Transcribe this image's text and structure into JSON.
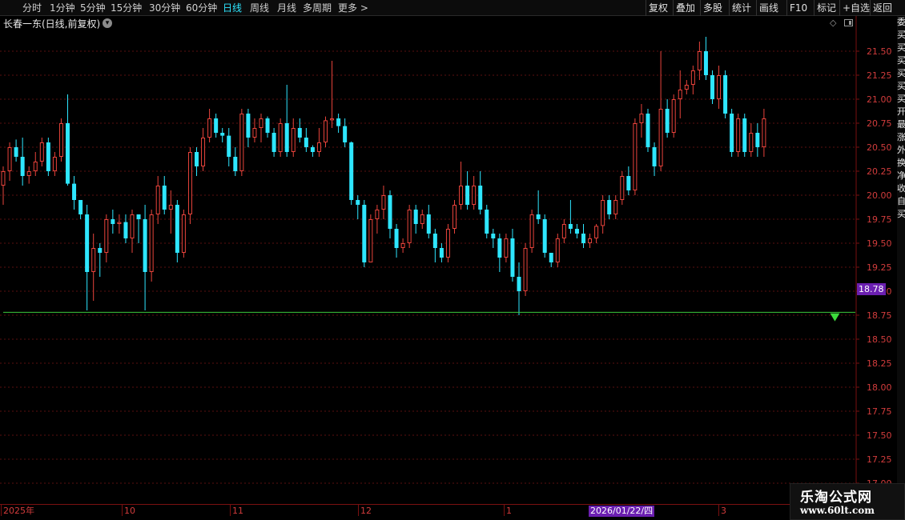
{
  "toolbar": {
    "left_items": [
      {
        "label": "分时",
        "active": false
      },
      {
        "label": "1分钟",
        "active": false
      },
      {
        "label": "5分钟",
        "active": false
      },
      {
        "label": "15分钟",
        "active": false
      },
      {
        "label": "30分钟",
        "active": false
      },
      {
        "label": "60分钟",
        "active": false
      },
      {
        "label": "日线",
        "active": true
      },
      {
        "label": "周线",
        "active": false
      },
      {
        "label": "月线",
        "active": false
      },
      {
        "label": "多周期",
        "active": false
      },
      {
        "label": "更多 >",
        "active": false
      }
    ],
    "right_items": [
      "复权",
      "叠加",
      "多股",
      "统计",
      "画线",
      "F10",
      "标记",
      "+自选",
      "返回"
    ]
  },
  "chart_header": {
    "title": "长春一东(日线,前复权)",
    "dropdown_icon": "chevron-down-icon"
  },
  "right_strip_chars": [
    "委",
    "买",
    "买",
    "买",
    "买",
    "买",
    "买",
    "开",
    "最",
    "涨",
    "外",
    "换",
    "净",
    "收",
    "自",
    "买"
  ],
  "date_axis": {
    "labels": [
      "2025年",
      "10",
      "11",
      "12",
      "1",
      "3"
    ],
    "highlight": "2026/01/22/四"
  },
  "current_price": "18.78",
  "watermark": {
    "title": "乐淘公式网",
    "url": "www.60lt.com"
  },
  "colors": {
    "up": "#e8433b",
    "down": "#2ee6ff",
    "grid": "#5a1010",
    "axis_text": "#d23c3c",
    "price_line": "#3cc83c",
    "highlight": "#6b1fb0"
  },
  "chart_data": {
    "type": "candlestick",
    "title": "长春一东(日线,前复权)",
    "yticks": [
      "21.50",
      "21.25",
      "21.00",
      "20.75",
      "20.50",
      "20.25",
      "20.00",
      "19.75",
      "19.50",
      "19.25",
      "19.00",
      "18.75",
      "18.50",
      "18.25",
      "18.00",
      "17.75",
      "17.50",
      "17.25",
      "17.00"
    ],
    "ylim": [
      16.8,
      21.7
    ],
    "reference_line": 18.78,
    "signal_marker": {
      "index": 129,
      "price": 18.72
    },
    "candles": [
      [
        20.1,
        20.3,
        19.9,
        20.25
      ],
      [
        20.25,
        20.55,
        20.15,
        20.5
      ],
      [
        20.5,
        20.58,
        20.35,
        20.4
      ],
      [
        20.4,
        20.6,
        20.1,
        20.2
      ],
      [
        20.2,
        20.3,
        20.12,
        20.25
      ],
      [
        20.25,
        20.45,
        20.2,
        20.35
      ],
      [
        20.35,
        20.6,
        20.3,
        20.55
      ],
      [
        20.55,
        20.6,
        20.2,
        20.25
      ],
      [
        20.25,
        20.45,
        20.2,
        20.4
      ],
      [
        20.4,
        20.8,
        20.35,
        20.75
      ],
      [
        20.75,
        21.05,
        20.1,
        20.12
      ],
      [
        20.12,
        20.2,
        19.85,
        19.95
      ],
      [
        19.95,
        19.95,
        19.75,
        19.8
      ],
      [
        19.8,
        19.9,
        18.8,
        19.2
      ],
      [
        19.2,
        19.6,
        18.9,
        19.45
      ],
      [
        19.45,
        19.5,
        19.15,
        19.4
      ],
      [
        19.4,
        19.8,
        19.3,
        19.75
      ],
      [
        19.75,
        19.85,
        19.6,
        19.7
      ],
      [
        19.7,
        19.8,
        19.6,
        19.72
      ],
      [
        19.72,
        19.8,
        19.5,
        19.55
      ],
      [
        19.55,
        19.85,
        19.4,
        19.8
      ],
      [
        19.8,
        19.8,
        19.5,
        19.75
      ],
      [
        19.75,
        19.9,
        18.8,
        19.2
      ],
      [
        19.2,
        19.85,
        19.1,
        19.8
      ],
      [
        19.8,
        20.2,
        19.7,
        20.1
      ],
      [
        20.1,
        20.2,
        19.8,
        19.85
      ],
      [
        19.85,
        20.05,
        19.6,
        19.9
      ],
      [
        19.9,
        19.95,
        19.3,
        19.4
      ],
      [
        19.4,
        19.85,
        19.35,
        19.8
      ],
      [
        19.8,
        20.5,
        19.7,
        20.45
      ],
      [
        20.45,
        20.5,
        20.2,
        20.3
      ],
      [
        20.3,
        20.7,
        20.25,
        20.6
      ],
      [
        20.6,
        20.9,
        20.55,
        20.8
      ],
      [
        20.8,
        20.85,
        20.6,
        20.65
      ],
      [
        20.65,
        20.7,
        20.55,
        20.62
      ],
      [
        20.62,
        20.7,
        20.3,
        20.4
      ],
      [
        20.4,
        20.5,
        20.2,
        20.25
      ],
      [
        20.25,
        20.9,
        20.2,
        20.85
      ],
      [
        20.85,
        20.9,
        20.5,
        20.6
      ],
      [
        20.6,
        20.8,
        20.55,
        20.7
      ],
      [
        20.7,
        20.85,
        20.55,
        20.8
      ],
      [
        20.8,
        20.82,
        20.6,
        20.65
      ],
      [
        20.65,
        20.7,
        20.4,
        20.45
      ],
      [
        20.45,
        20.8,
        20.4,
        20.75
      ],
      [
        20.75,
        21.15,
        20.4,
        20.45
      ],
      [
        20.45,
        20.8,
        20.4,
        20.7
      ],
      [
        20.7,
        20.8,
        20.55,
        20.6
      ],
      [
        20.6,
        20.7,
        20.45,
        20.5
      ],
      [
        20.5,
        20.52,
        20.4,
        20.45
      ],
      [
        20.45,
        20.7,
        20.4,
        20.55
      ],
      [
        20.55,
        20.82,
        20.5,
        20.78
      ],
      [
        20.78,
        21.4,
        20.7,
        20.8
      ],
      [
        20.8,
        20.85,
        20.65,
        20.72
      ],
      [
        20.72,
        20.8,
        20.5,
        20.55
      ],
      [
        20.55,
        20.56,
        19.9,
        19.95
      ],
      [
        19.95,
        20.0,
        19.75,
        19.9
      ],
      [
        19.9,
        19.95,
        19.25,
        19.3
      ],
      [
        19.3,
        19.8,
        19.3,
        19.75
      ],
      [
        19.75,
        19.9,
        19.6,
        19.85
      ],
      [
        19.85,
        20.1,
        19.75,
        20.0
      ],
      [
        20.0,
        20.05,
        19.55,
        19.65
      ],
      [
        19.65,
        19.7,
        19.35,
        19.45
      ],
      [
        19.45,
        19.55,
        19.4,
        19.5
      ],
      [
        19.5,
        19.9,
        19.45,
        19.85
      ],
      [
        19.85,
        19.9,
        19.6,
        19.7
      ],
      [
        19.7,
        19.85,
        19.65,
        19.8
      ],
      [
        19.8,
        19.9,
        19.55,
        19.6
      ],
      [
        19.6,
        19.65,
        19.3,
        19.45
      ],
      [
        19.45,
        19.5,
        19.3,
        19.35
      ],
      [
        19.35,
        19.7,
        19.3,
        19.65
      ],
      [
        19.65,
        19.95,
        19.6,
        19.9
      ],
      [
        19.9,
        20.35,
        19.85,
        20.1
      ],
      [
        20.1,
        20.25,
        19.85,
        19.9
      ],
      [
        19.9,
        20.2,
        19.85,
        20.1
      ],
      [
        20.1,
        20.25,
        19.8,
        19.85
      ],
      [
        19.85,
        19.9,
        19.55,
        19.6
      ],
      [
        19.6,
        19.65,
        19.45,
        19.55
      ],
      [
        19.55,
        19.6,
        19.2,
        19.35
      ],
      [
        19.35,
        19.6,
        19.3,
        19.55
      ],
      [
        19.55,
        19.65,
        19.1,
        19.15
      ],
      [
        19.15,
        19.3,
        18.75,
        19.0
      ],
      [
        19.0,
        19.5,
        18.95,
        19.45
      ],
      [
        19.45,
        19.85,
        19.4,
        19.8
      ],
      [
        19.8,
        20.05,
        19.7,
        19.75
      ],
      [
        19.75,
        19.8,
        19.35,
        19.4
      ],
      [
        19.4,
        19.35,
        19.25,
        19.3
      ],
      [
        19.3,
        19.6,
        19.25,
        19.55
      ],
      [
        19.55,
        19.75,
        19.5,
        19.7
      ],
      [
        19.7,
        19.95,
        19.6,
        19.65
      ],
      [
        19.65,
        19.7,
        19.55,
        19.6
      ],
      [
        19.6,
        19.7,
        19.45,
        19.5
      ],
      [
        19.5,
        19.6,
        19.45,
        19.55
      ],
      [
        19.55,
        19.7,
        19.5,
        19.68
      ],
      [
        19.68,
        20.0,
        19.6,
        19.95
      ],
      [
        19.95,
        20.0,
        19.75,
        19.8
      ],
      [
        19.8,
        20.0,
        19.75,
        19.95
      ],
      [
        19.95,
        20.25,
        19.9,
        20.2
      ],
      [
        20.2,
        20.3,
        20.0,
        20.05
      ],
      [
        20.05,
        20.8,
        20.0,
        20.75
      ],
      [
        20.75,
        20.95,
        20.6,
        20.85
      ],
      [
        20.85,
        20.9,
        20.45,
        20.5
      ],
      [
        20.5,
        20.55,
        20.2,
        20.3
      ],
      [
        20.3,
        21.5,
        20.25,
        20.9
      ],
      [
        20.9,
        21.0,
        20.6,
        20.65
      ],
      [
        20.65,
        21.05,
        20.6,
        21.0
      ],
      [
        21.0,
        21.3,
        20.8,
        21.1
      ],
      [
        21.1,
        21.2,
        21.05,
        21.15
      ],
      [
        21.15,
        21.35,
        21.05,
        21.3
      ],
      [
        21.3,
        21.6,
        21.2,
        21.5
      ],
      [
        21.5,
        21.65,
        21.2,
        21.25
      ],
      [
        21.25,
        21.3,
        20.95,
        21.0
      ],
      [
        21.0,
        21.35,
        20.9,
        21.25
      ],
      [
        21.25,
        21.3,
        20.8,
        20.85
      ],
      [
        20.85,
        20.9,
        20.4,
        20.45
      ],
      [
        20.45,
        20.85,
        20.4,
        20.8
      ],
      [
        20.8,
        20.85,
        20.4,
        20.45
      ],
      [
        20.45,
        20.75,
        20.4,
        20.65
      ],
      [
        20.65,
        20.75,
        20.4,
        20.5
      ],
      [
        20.5,
        20.9,
        20.4,
        20.8
      ]
    ]
  }
}
